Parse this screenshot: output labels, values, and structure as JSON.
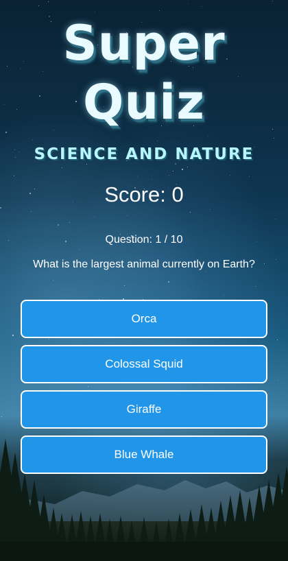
{
  "title": {
    "line1": "Super",
    "line2": "Quiz"
  },
  "category": "SCIENCE AND NATURE",
  "score": {
    "label": "Score:",
    "value": "0",
    "text": "Score: 0"
  },
  "question": {
    "counter": "Question: 1 / 10",
    "text": "What is the largest animal currently on Earth?"
  },
  "answers": [
    {
      "label": "Orca"
    },
    {
      "label": "Colossal Squid"
    },
    {
      "label": "Giraffe"
    },
    {
      "label": "Blue Whale"
    }
  ],
  "colors": {
    "answer_button": "#2196e8",
    "title": "#e9fbff",
    "category": "#b8f6ff"
  }
}
